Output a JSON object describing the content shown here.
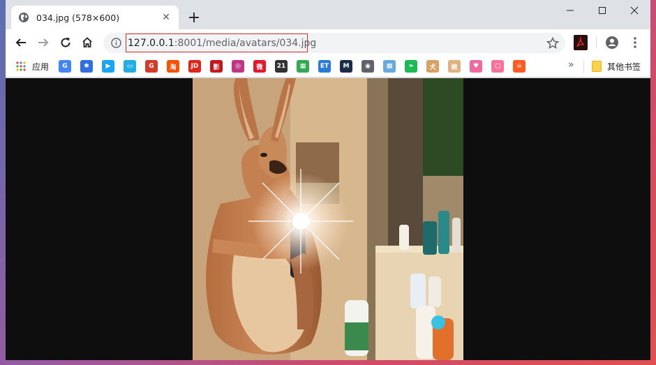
{
  "tab": {
    "title": "034.jpg (578×600)",
    "close_glyph": "✕"
  },
  "newtab_glyph": "+",
  "address": {
    "host": "127.0.0.1",
    "rest": ":8001/media/avatars/034.jpg"
  },
  "bookmarks": {
    "apps_label": "应用",
    "overflow_glyph": "»",
    "other_label": "其他书签",
    "items": [
      {
        "icon": "google-translate-icon",
        "color": "#4285f4",
        "glyph": "G"
      },
      {
        "icon": "baidu-paw-icon",
        "color": "#2f6ee5",
        "glyph": "✱"
      },
      {
        "icon": "video-play-icon",
        "color": "#1aa4f4",
        "glyph": "▶"
      },
      {
        "icon": "bilibili-tv-icon",
        "color": "#23ade5",
        "glyph": "▭"
      },
      {
        "icon": "g-logo-icon",
        "color": "#d33a28",
        "glyph": "G"
      },
      {
        "icon": "taobao-icon",
        "color": "#ff5000",
        "glyph": "淘"
      },
      {
        "icon": "jd-icon",
        "color": "#e1251b",
        "glyph": "JD"
      },
      {
        "icon": "cinema-icon",
        "color": "#c4161c",
        "glyph": "影"
      },
      {
        "icon": "instagram-icon",
        "color": "#c13584",
        "glyph": "◎"
      },
      {
        "icon": "weibo-icon",
        "color": "#e6162d",
        "glyph": "微"
      },
      {
        "icon": "poker-icon",
        "color": "#333333",
        "glyph": "21"
      },
      {
        "icon": "photos-icon",
        "color": "#34a853",
        "glyph": "▦"
      },
      {
        "icon": "cctv-icon",
        "color": "#2a7bd8",
        "glyph": "ET"
      },
      {
        "icon": "m-logo-icon",
        "color": "#1a2b4c",
        "glyph": "M"
      },
      {
        "icon": "globe-icon",
        "color": "#5f6368",
        "glyph": "◉"
      },
      {
        "icon": "puzzle-icon",
        "color": "#6aa8e0",
        "glyph": "▩"
      },
      {
        "icon": "leaf-icon",
        "color": "#1db954",
        "glyph": "❧"
      },
      {
        "icon": "shiba-icon",
        "color": "#d9a066",
        "glyph": "犬"
      },
      {
        "icon": "anime-girl-icon",
        "color": "#e0b080",
        "glyph": "娘"
      },
      {
        "icon": "pink-girl-icon",
        "color": "#f06aa0",
        "glyph": "♥"
      },
      {
        "icon": "tv-pink-icon",
        "color": "#fb7299",
        "glyph": "▢"
      },
      {
        "icon": "skull-icon",
        "color": "#ff5a1f",
        "glyph": "☠"
      }
    ]
  },
  "colors": {
    "accent_outline": "#d93025",
    "content_bg": "#0e0e0e"
  }
}
